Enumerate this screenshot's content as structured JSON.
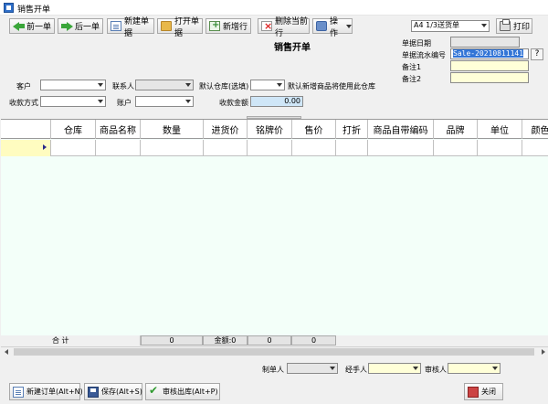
{
  "window": {
    "title": "销售开单"
  },
  "toolbar": {
    "prev": "前一单",
    "next": "后一单",
    "new_bill": "新建单据",
    "open_bill": "打开单据",
    "add_row": "新增行",
    "delete_row": "删除当前行",
    "operate": "操作",
    "print_template": "A4 1/3送货单",
    "print": "打印"
  },
  "form": {
    "title": "销售开单",
    "bill_date_label": "单据日期",
    "bill_date_value": "",
    "serial_label": "单据流水编号",
    "serial_value": "Sale-20210811141",
    "help": "?",
    "note1_label": "备注1",
    "note2_label": "备注2",
    "customer_label": "客户",
    "contact_label": "联系人",
    "default_warehouse_label": "默认仓库(选填)",
    "default_warehouse_hint": "默认新增商品将使用此仓库",
    "payment_method_label": "收款方式",
    "account_label": "账户",
    "amount_received_label": "收款金额",
    "amount_received_value": "0.00"
  },
  "grid": {
    "columns": [
      "仓库",
      "商品名称",
      "数量",
      "进货价",
      "铭牌价",
      "售价",
      "打折",
      "商品自带编码",
      "品牌",
      "单位",
      "颜色"
    ]
  },
  "summary": {
    "total_label": "合 计",
    "quantity": "0",
    "amount_label": "金额:",
    "amount": "0",
    "col3": "0",
    "col4": "0"
  },
  "footer": {
    "maker_label": "制单人",
    "handler_label": "经手人",
    "reviewer_label": "审核人"
  },
  "bottom_buttons": {
    "new_order": "新建订单(Alt+N)",
    "save": "保存(Alt+S)",
    "review": "审核出库(Alt+P)",
    "close": "关闭"
  }
}
